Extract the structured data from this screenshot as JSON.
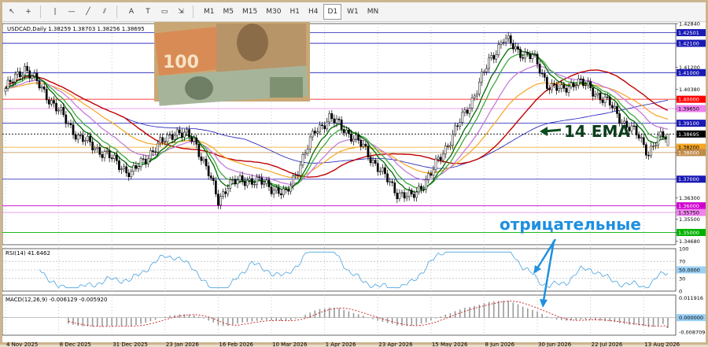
{
  "toolbar": {
    "tools": [
      "cursor-icon",
      "crosshair-icon",
      "vertical-line-icon",
      "horizontal-line-icon",
      "trendline-icon",
      "channel-icon",
      "text-icon",
      "label-icon",
      "shapes-icon",
      "arrow-dropdown-icon"
    ],
    "timeframes": [
      "M1",
      "M5",
      "M15",
      "M30",
      "H1",
      "H4",
      "D1",
      "W1",
      "MN"
    ],
    "active_timeframe": "D1"
  },
  "chart_header": "USDCAD,Daily  1.38259 1.38703 1.38256 1.38695",
  "rsi_header": "RSI(14) 41.6462",
  "macd_header": "MACD(12,26,9) -0.006129 -0.005920",
  "annotations": {
    "ema_label": "14 EMA",
    "negative_label": "отрицательные"
  },
  "colors": {
    "background": "#ffffff",
    "candles": "#000000",
    "ema_fast": "#006b00",
    "ema_mid": "#3fa93f",
    "ema_slow": "#c37fd9",
    "ma_orange": "#f5a623",
    "ma_red": "#c00000",
    "ma_blue": "#1a1ab5",
    "rsi": "#4aa3df",
    "macd_signal": "#c00000",
    "arrow_blue": "#1e8fe0",
    "arrow_green": "#0b4d1e"
  },
  "chart_data": {
    "type": "line",
    "symbol": "USDCAD",
    "timeframe": "Daily",
    "ylim": [
      1.3454,
      1.4284
    ],
    "price_ticks": [
      "1.42840",
      "1.42501",
      "1.42100",
      "1.41200",
      "1.41000",
      "1.40380",
      "1.40000",
      "1.39650",
      "1.39100",
      "1.38695",
      "1.38200",
      "1.38000",
      "1.37000",
      "1.36300",
      "1.36000",
      "1.35750",
      "1.35500",
      "1.35000",
      "1.34680"
    ],
    "highlighted_levels": [
      {
        "value": 1.42501,
        "color": "#1a1ab5"
      },
      {
        "value": 1.421,
        "color": "#1a1ab5"
      },
      {
        "value": 1.41,
        "color": "#1a1ab5"
      },
      {
        "value": 1.4,
        "color": "#ff0000"
      },
      {
        "value": 1.3965,
        "color": "#ee82ee"
      },
      {
        "value": 1.391,
        "color": "#1a1ab5"
      },
      {
        "value": 1.38695,
        "color": "#000000"
      },
      {
        "value": 1.382,
        "color": "#f5a623"
      },
      {
        "value": 1.38,
        "color": "#c08a4a"
      },
      {
        "value": 1.37,
        "color": "#1a1ab5"
      },
      {
        "value": 1.36,
        "color": "#d100d1"
      },
      {
        "value": 1.3575,
        "color": "#ee82ee"
      },
      {
        "value": 1.35,
        "color": "#00b000"
      }
    ],
    "x_labels": [
      "4 Nov 2025",
      "8 Dec 2025",
      "31 Dec 2025",
      "23 Jan 2026",
      "16 Feb 2026",
      "10 Mar 2026",
      "1 Apr 2026",
      "23 Apr 2026",
      "15 May 2026",
      "8 Jun 2026",
      "30 Jun 2026",
      "22 Jul 2026",
      "13 Aug 2026"
    ],
    "close_path": [
      [
        0,
        1.404
      ],
      [
        8,
        1.412
      ],
      [
        20,
        1.398
      ],
      [
        30,
        1.386
      ],
      [
        42,
        1.379
      ],
      [
        52,
        1.372
      ],
      [
        60,
        1.38
      ],
      [
        70,
        1.388
      ],
      [
        78,
        1.385
      ],
      [
        84,
        1.372
      ],
      [
        88,
        1.362
      ],
      [
        92,
        1.368
      ],
      [
        100,
        1.37
      ],
      [
        108,
        1.368
      ],
      [
        116,
        1.364
      ],
      [
        122,
        1.376
      ],
      [
        128,
        1.388
      ],
      [
        134,
        1.393
      ],
      [
        140,
        1.389
      ],
      [
        148,
        1.382
      ],
      [
        156,
        1.372
      ],
      [
        162,
        1.365
      ],
      [
        168,
        1.363
      ],
      [
        176,
        1.372
      ],
      [
        184,
        1.385
      ],
      [
        192,
        1.398
      ],
      [
        200,
        1.414
      ],
      [
        206,
        1.423
      ],
      [
        212,
        1.418
      ],
      [
        218,
        1.416
      ],
      [
        224,
        1.406
      ],
      [
        230,
        1.403
      ],
      [
        236,
        1.407
      ],
      [
        242,
        1.404
      ],
      [
        250,
        1.398
      ],
      [
        256,
        1.391
      ],
      [
        262,
        1.386
      ],
      [
        266,
        1.38
      ],
      [
        270,
        1.385
      ],
      [
        274,
        1.387
      ]
    ],
    "rsi": {
      "ylim": [
        0,
        100
      ],
      "levels": [
        30,
        50,
        70
      ],
      "last": 41.6462,
      "ticks": [
        "100",
        "70",
        "50.0000",
        "30",
        "0"
      ]
    },
    "macd": {
      "main": -0.006129,
      "signal": -0.00592,
      "ticks": [
        "0.011916",
        "0.000000",
        "-0.008709"
      ],
      "ylim": [
        -0.0105,
        0.0135
      ]
    }
  }
}
